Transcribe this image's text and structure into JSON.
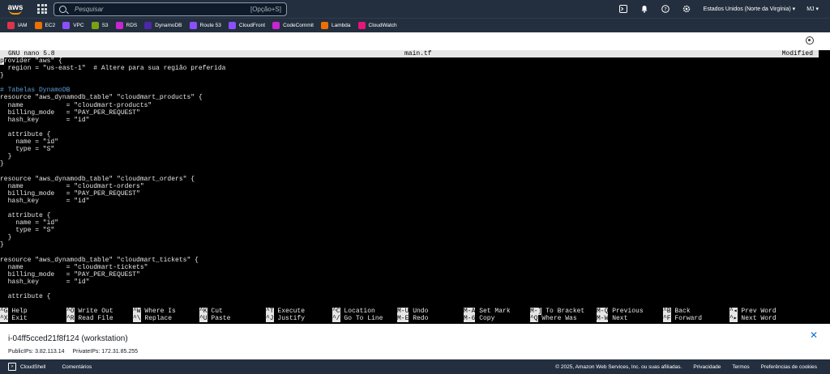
{
  "topbar": {
    "logo": "aws",
    "search_placeholder": "Pesquisar",
    "search_shortcut": "[Opção+S]",
    "region": "Estados Unidos (Norte da Virgínia)",
    "user": "MJ"
  },
  "favorites": [
    {
      "label": "IAM",
      "color": "#dd344c",
      "icon": "iam-icon"
    },
    {
      "label": "EC2",
      "color": "#ed7100",
      "icon": "ec2-icon"
    },
    {
      "label": "VPC",
      "color": "#8c4fff",
      "icon": "vpc-icon"
    },
    {
      "label": "S3",
      "color": "#7aa116",
      "icon": "s3-icon"
    },
    {
      "label": "RDS",
      "color": "#c925d1",
      "icon": "rds-icon"
    },
    {
      "label": "DynamoDB",
      "color": "#4d27aa",
      "icon": "dynamodb-icon"
    },
    {
      "label": "Route 53",
      "color": "#8c4fff",
      "icon": "route53-icon"
    },
    {
      "label": "CloudFront",
      "color": "#8c4fff",
      "icon": "cloudfront-icon"
    },
    {
      "label": "CodeCommit",
      "color": "#c925d1",
      "icon": "codecommit-icon"
    },
    {
      "label": "Lambda",
      "color": "#ed7100",
      "icon": "lambda-icon"
    },
    {
      "label": "CloudWatch",
      "color": "#e7157b",
      "icon": "cloudwatch-icon"
    }
  ],
  "nano": {
    "version": "GNU nano 5.8",
    "filename": "main.tf",
    "status": "Modified",
    "lines": [
      "provider \"aws\" {",
      "  region = \"us-east-1\"  # Altere para sua região preferida",
      "}",
      "",
      "# Tabelas DynamoDB",
      "resource \"aws_dynamodb_table\" \"cloudmart_products\" {",
      "  name           = \"cloudmart-products\"",
      "  billing_mode   = \"PAY_PER_REQUEST\"",
      "  hash_key       = \"id\"",
      "",
      "  attribute {",
      "    name = \"id\"",
      "    type = \"S\"",
      "  }",
      "}",
      "",
      "resource \"aws_dynamodb_table\" \"cloudmart_orders\" {",
      "  name           = \"cloudmart-orders\"",
      "  billing_mode   = \"PAY_PER_REQUEST\"",
      "  hash_key       = \"id\"",
      "",
      "  attribute {",
      "    name = \"id\"",
      "    type = \"S\"",
      "  }",
      "}",
      "",
      "resource \"aws_dynamodb_table\" \"cloudmart_tickets\" {",
      "  name           = \"cloudmart-tickets\"",
      "  billing_mode   = \"PAY_PER_REQUEST\"",
      "  hash_key       = \"id\"",
      "",
      "  attribute {"
    ],
    "shortcuts_row1": [
      {
        "key": "^G",
        "label": "Help"
      },
      {
        "key": "^O",
        "label": "Write Out"
      },
      {
        "key": "^W",
        "label": "Where Is"
      },
      {
        "key": "^K",
        "label": "Cut"
      },
      {
        "key": "^T",
        "label": "Execute"
      },
      {
        "key": "^C",
        "label": "Location"
      },
      {
        "key": "M-U",
        "label": "Undo"
      },
      {
        "key": "M-A",
        "label": "Set Mark"
      },
      {
        "key": "M-]",
        "label": "To Bracket"
      },
      {
        "key": "M-Q",
        "label": "Previous"
      },
      {
        "key": "^B",
        "label": "Back"
      },
      {
        "key": "^◂",
        "label": "Prev Word"
      }
    ],
    "shortcuts_row2": [
      {
        "key": "^X",
        "label": "Exit"
      },
      {
        "key": "^R",
        "label": "Read File"
      },
      {
        "key": "^\\",
        "label": "Replace"
      },
      {
        "key": "^U",
        "label": "Paste"
      },
      {
        "key": "^J",
        "label": "Justify"
      },
      {
        "key": "^/",
        "label": "Go To Line"
      },
      {
        "key": "M-E",
        "label": "Redo"
      },
      {
        "key": "M-6",
        "label": "Copy"
      },
      {
        "key": "^Q",
        "label": "Where Was"
      },
      {
        "key": "M-W",
        "label": "Next"
      },
      {
        "key": "^F",
        "label": "Forward"
      },
      {
        "key": "^▸",
        "label": "Next Word"
      }
    ]
  },
  "instance": {
    "id": "i-04ff5cced21f8f124 (workstation)",
    "public_ips": "PublicIPs: 3.82.113.14",
    "private_ips": "PrivateIPs: 172.31.85.255"
  },
  "footer": {
    "cloudshell": "CloudShell",
    "comments": "Comentários",
    "copyright": "© 2025, Amazon Web Services, Inc. ou suas afiliadas.",
    "privacy": "Privacidade",
    "terms": "Termos",
    "cookies": "Preferências de cookies"
  }
}
